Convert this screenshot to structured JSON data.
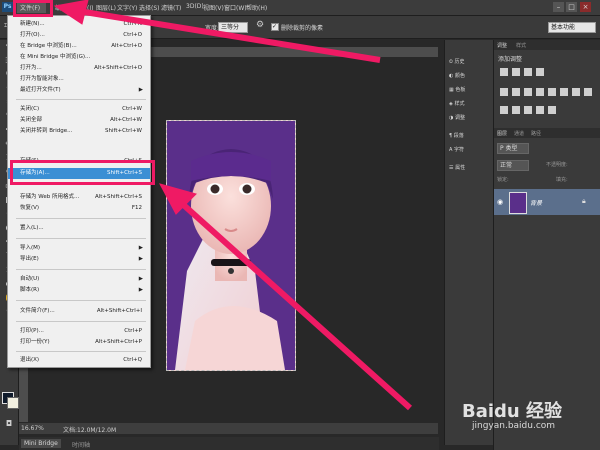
{
  "menubar": {
    "items": [
      "文件(F)",
      "编(E)",
      "图像(I)",
      "图层(L)",
      "文字(Y)",
      "选择(S)",
      "滤镜(T)",
      "3D(D)",
      "视图(V)",
      "窗口(W)",
      "帮助(H)"
    ],
    "window_buttons": [
      "–",
      "□",
      "×"
    ]
  },
  "options": {
    "style_value": "正常",
    "style_label": "样式:",
    "size_label": "宽度:",
    "size_value": "三等分",
    "checkbox_label": "删除裁剪的像素",
    "workspace": "基本功能"
  },
  "file_menu": {
    "items": [
      {
        "label": "新建(N)...",
        "shortcut": "Ctrl+N"
      },
      {
        "label": "打开(O)...",
        "shortcut": "Ctrl+O"
      },
      {
        "label": "在 Bridge 中浏览(B)...",
        "shortcut": "Alt+Ctrl+O"
      },
      {
        "label": "在 Mini Bridge 中浏览(G)...",
        "shortcut": ""
      },
      {
        "label": "打开为...",
        "shortcut": "Alt+Shift+Ctrl+O"
      },
      {
        "label": "打开为智能对象...",
        "shortcut": ""
      },
      {
        "label": "最近打开文件(T)",
        "shortcut": "▶"
      },
      {
        "label": "关闭(C)",
        "shortcut": "Ctrl+W"
      },
      {
        "label": "关闭全部",
        "shortcut": "Alt+Ctrl+W"
      },
      {
        "label": "关闭并转到 Bridge...",
        "shortcut": "Shift+Ctrl+W"
      },
      {
        "label": "存储(S)",
        "shortcut": "Ctrl+S"
      },
      {
        "label": "存储为(A)...",
        "shortcut": "Shift+Ctrl+S"
      },
      {
        "label": "存储为 Web 所用格式...",
        "shortcut": "Alt+Shift+Ctrl+S"
      },
      {
        "label": "恢复(V)",
        "shortcut": "F12"
      },
      {
        "label": "置入(L)...",
        "shortcut": ""
      },
      {
        "label": "导入(M)",
        "shortcut": "▶"
      },
      {
        "label": "导出(E)",
        "shortcut": "▶"
      },
      {
        "label": "自动(U)",
        "shortcut": "▶"
      },
      {
        "label": "脚本(R)",
        "shortcut": "▶"
      },
      {
        "label": "文件简介(F)...",
        "shortcut": "Alt+Shift+Ctrl+I"
      },
      {
        "label": "打印(P)...",
        "shortcut": "Ctrl+P"
      },
      {
        "label": "打印一份(Y)",
        "shortcut": "Alt+Shift+Ctrl+P"
      },
      {
        "label": "退出(X)",
        "shortcut": "Ctrl+Q"
      }
    ]
  },
  "document_tab": "",
  "status": {
    "zoom": "16.67%",
    "doc": "文档:12.0M/12.0M",
    "bottom_tab_1": "Mini Bridge",
    "bottom_tab_2": "时间轴"
  },
  "right_icons": [
    "历史",
    "颜色",
    "色板",
    "样式",
    "调整",
    "段落",
    "字符",
    "属性"
  ],
  "adjustments": {
    "tabs": [
      "调整",
      "样式"
    ],
    "title": "添加调整"
  },
  "layers": {
    "tabs": [
      "图层",
      "通道",
      "路径"
    ],
    "filter": "P 类型",
    "mode": "正常",
    "opacity_label": "不透明度:",
    "lock_label": "锁定:",
    "fill_label": "填充:",
    "layer_name": "背景"
  },
  "watermark": {
    "brand": "Baidu 经验",
    "url": "jingyan.baidu.com"
  },
  "colors": {
    "highlight": "#ef1a64",
    "selected": "#3b8fd4"
  }
}
